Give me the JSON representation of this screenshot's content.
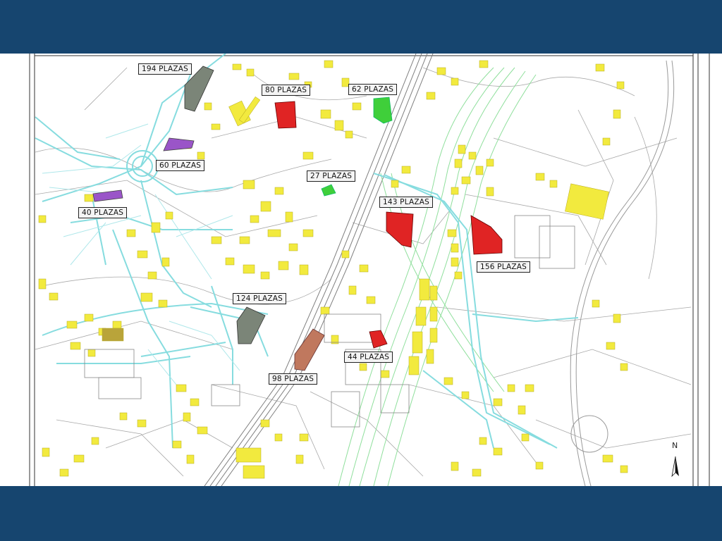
{
  "colors": {
    "band": "#16456f",
    "road_cyan": "#86dcdf",
    "river_green": "#8fdf9c",
    "building_yellow": "#f2ea3e",
    "parking_red": "#e02424",
    "parking_green": "#3fcf3a",
    "parking_purple": "#9a55c8",
    "parking_grey": "#7b8578",
    "parking_brown": "#c0785e",
    "lines": "#9a9a9a"
  },
  "parking_labels": [
    {
      "id": "p194",
      "text": "194 PLAZAS",
      "color": "grey"
    },
    {
      "id": "p80",
      "text": "80 PLAZAS",
      "color": "red"
    },
    {
      "id": "p62",
      "text": "62 PLAZAS",
      "color": "green"
    },
    {
      "id": "p60",
      "text": "60 PLAZAS",
      "color": "purple"
    },
    {
      "id": "p27",
      "text": "27 PLAZAS",
      "color": "green"
    },
    {
      "id": "p40",
      "text": "40 PLAZAS",
      "color": "purple"
    },
    {
      "id": "p143",
      "text": "143 PLAZAS",
      "color": "red"
    },
    {
      "id": "p156",
      "text": "156 PLAZAS",
      "color": "red"
    },
    {
      "id": "p124",
      "text": "124 PLAZAS",
      "color": "grey"
    },
    {
      "id": "p44",
      "text": "44 PLAZAS",
      "color": "red"
    },
    {
      "id": "p98",
      "text": "98 PLAZAS",
      "color": "brown"
    }
  ],
  "north_arrow": {
    "letter": "N",
    "icon": "north-arrow-icon"
  }
}
